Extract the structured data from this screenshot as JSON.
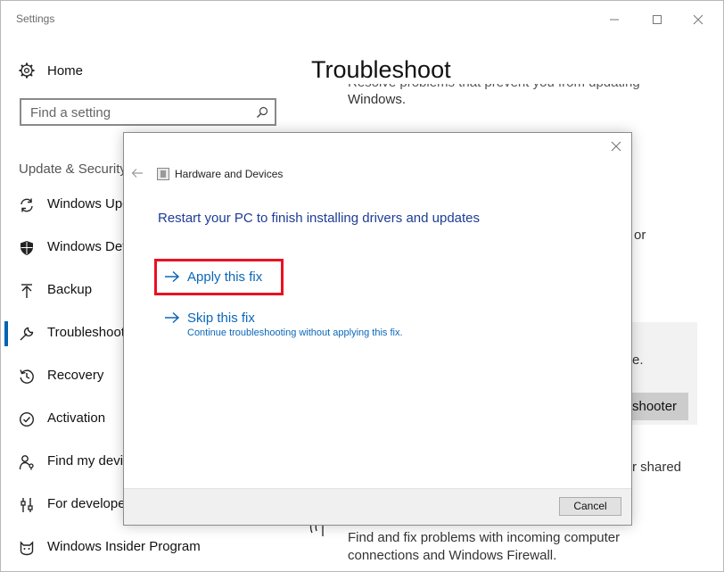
{
  "window": {
    "title": "Settings"
  },
  "sidebar": {
    "home_label": "Home",
    "search_placeholder": "Find a setting",
    "section_title": "Update & Security",
    "items": [
      {
        "label": "Windows Update",
        "icon": "refresh-icon"
      },
      {
        "label": "Windows Defender",
        "icon": "shield-icon"
      },
      {
        "label": "Backup",
        "icon": "backup-arrow-icon"
      },
      {
        "label": "Troubleshoot",
        "icon": "wrench-icon",
        "active": true
      },
      {
        "label": "Recovery",
        "icon": "history-icon"
      },
      {
        "label": "Activation",
        "icon": "check-circle-icon"
      },
      {
        "label": "Find my device",
        "icon": "person-location-icon"
      },
      {
        "label": "For developers",
        "icon": "developer-tools-icon"
      },
      {
        "label": "Windows Insider Program",
        "icon": "insider-cat-icon"
      }
    ]
  },
  "main": {
    "page_title": "Troubleshoot",
    "top_desc_line1": "Resolve problems that prevent you from updating",
    "top_desc_line2": "Windows.",
    "fragment_or": "or",
    "fragment_e": "e.",
    "button_fragment": "shooter",
    "fragment_shared": "r shared",
    "network_desc_line1": "Find and fix problems with incoming computer",
    "network_desc_line2": "connections and Windows Firewall."
  },
  "dialog": {
    "title": "Hardware and Devices",
    "heading": "Restart your PC to finish installing drivers and updates",
    "apply_label": "Apply this fix",
    "skip_label": "Skip this fix",
    "skip_sub": "Continue troubleshooting without applying this fix.",
    "cancel_label": "Cancel",
    "highlight_color": "#e81123",
    "link_color": "#0b67b8"
  },
  "colors": {
    "accent": "#0063b1",
    "heading_blue": "#1e3c96"
  }
}
